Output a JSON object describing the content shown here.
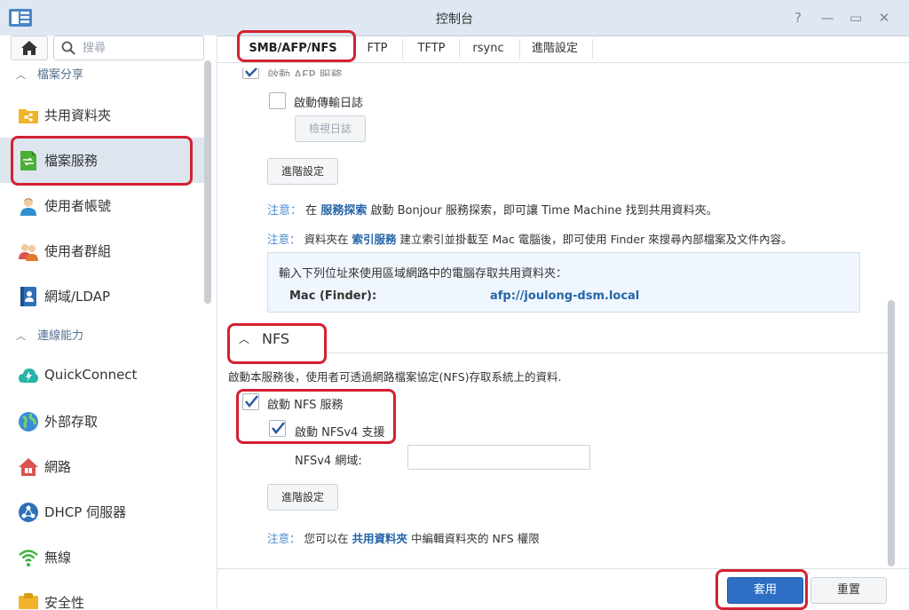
{
  "window": {
    "title": "控制台",
    "help_icon": "?",
    "minimize_icon": "—",
    "maximize_icon": "▭",
    "close_icon": "✕"
  },
  "sidebar": {
    "search_placeholder": "搜尋",
    "sections": [
      {
        "label": "檔案分享",
        "items": [
          {
            "label": "共用資料夾",
            "icon": "shared-folder-icon"
          },
          {
            "label": "檔案服務",
            "icon": "file-services-icon",
            "active": true
          },
          {
            "label": "使用者帳號",
            "icon": "user-icon"
          },
          {
            "label": "使用者群組",
            "icon": "group-icon"
          },
          {
            "label": "網域/LDAP",
            "icon": "domain-ldap-icon"
          }
        ]
      },
      {
        "label": "連線能力",
        "items": [
          {
            "label": "QuickConnect",
            "icon": "quickconnect-icon"
          },
          {
            "label": "外部存取",
            "icon": "external-access-icon"
          },
          {
            "label": "網路",
            "icon": "network-icon"
          },
          {
            "label": "DHCP 伺服器",
            "icon": "dhcp-server-icon"
          },
          {
            "label": "無線",
            "icon": "wireless-icon"
          },
          {
            "label": "安全性",
            "icon": "security-icon"
          }
        ]
      }
    ]
  },
  "tabs": [
    {
      "label": "SMB/AFP/NFS",
      "active": true
    },
    {
      "label": "FTP"
    },
    {
      "label": "TFTP"
    },
    {
      "label": "rsync"
    },
    {
      "label": "進階設定"
    }
  ],
  "afp": {
    "enable_afp_label": "啟動 AFP 服務",
    "enable_log_label": "啟動傳輸日誌",
    "view_log_button": "檢視日誌",
    "advanced_button": "進階設定",
    "note1": {
      "prefix": "注意：",
      "pre": "在",
      "link": "服務探索",
      "post": "啟動 Bonjour 服務探索，即可讓 Time Machine 找到共用資料夾。"
    },
    "note2": {
      "prefix": "注意：",
      "pre": "資料夾在",
      "link": "索引服務",
      "post": "建立索引並掛載至 Mac 電腦後，即可使用 Finder 來搜尋內部檔案及文件內容。"
    },
    "info": {
      "intro": "輸入下列位址來使用區域網路中的電腦存取共用資料夾：",
      "key": "Mac (Finder):",
      "value": "afp://joulong-dsm.local"
    }
  },
  "nfs": {
    "title": "NFS",
    "description": "啟動本服務後，使用者可透過網路檔案協定(NFS)存取系統上的資料.",
    "enable_nfs_label": "啟動 NFS 服務",
    "enable_nfs_checked": true,
    "enable_nfsv4_label": "啟動 NFSv4 支援",
    "enable_nfsv4_checked": true,
    "domain_label": "NFSv4 網域:",
    "domain_value": "",
    "advanced_button": "進階設定",
    "note": {
      "prefix": "注意：",
      "pre": "您可以在",
      "link": "共用資料夾",
      "post": "中編輯資料夾的 NFS 權限"
    }
  },
  "footer": {
    "apply_button": "套用",
    "reset_button": "重置"
  },
  "colors": {
    "accent": "#2c6fc4",
    "highlight": "#d3212f",
    "note": "#4a8bd0",
    "link": "#2465a8"
  }
}
